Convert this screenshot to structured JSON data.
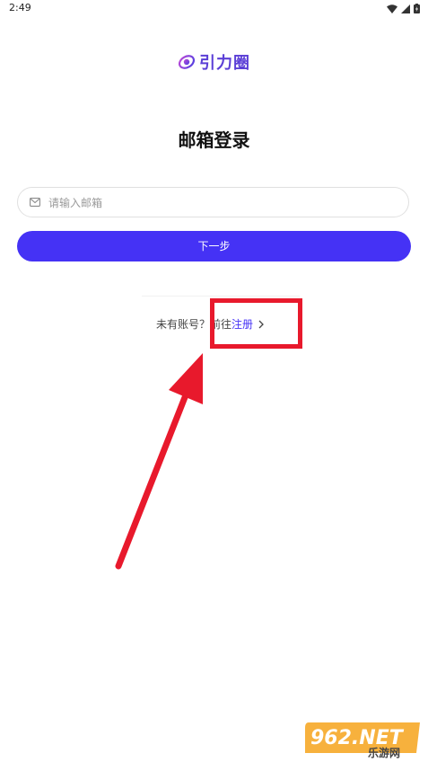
{
  "status_bar": {
    "time": "2:49"
  },
  "logo": {
    "text": "引力圈"
  },
  "title": "邮箱登录",
  "email": {
    "placeholder": "请输入邮箱",
    "value": ""
  },
  "next_button_label": "下一步",
  "register": {
    "prompt": "未有账号？前往",
    "link": "注册"
  },
  "watermark": {
    "main": "962.NET",
    "sub": "乐游网"
  },
  "colors": {
    "accent": "#4532f5",
    "highlight": "#e8192c",
    "logo": "#5b3fd6"
  }
}
